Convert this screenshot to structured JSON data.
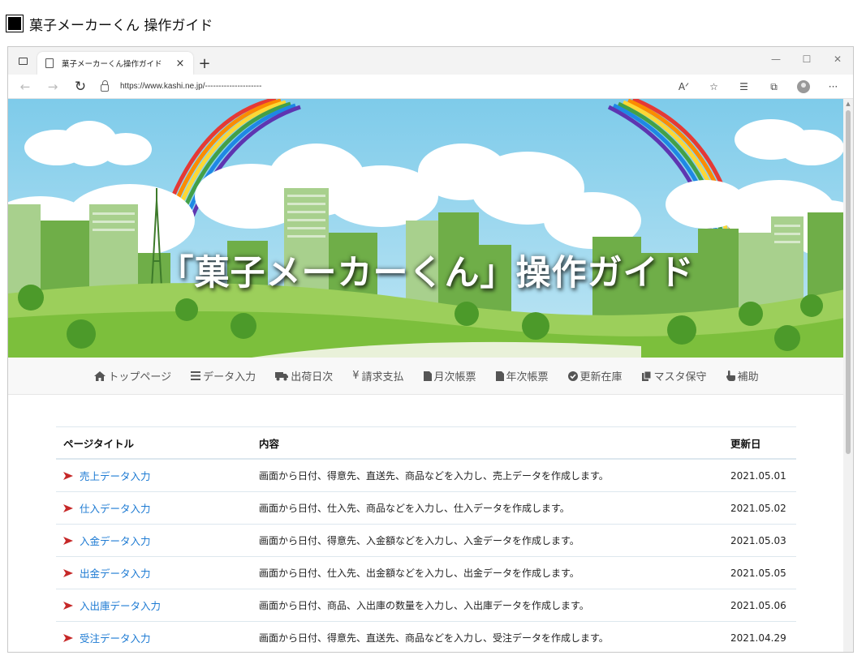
{
  "document": {
    "title": "菓子メーカーくん 操作ガイド"
  },
  "browser": {
    "tab_title": "菓子メーカーくん操作ガイド",
    "url": "https://www.kashi.ne.jp/---------------------"
  },
  "hero": {
    "title": "「菓子メーカーくん」操作ガイド"
  },
  "menu": [
    {
      "icon": "home-icon",
      "label": "トップページ"
    },
    {
      "icon": "list-icon",
      "label": "データ入力"
    },
    {
      "icon": "truck-icon",
      "label": "出荷日次"
    },
    {
      "icon": "yen-icon",
      "label": "請求支払"
    },
    {
      "icon": "document-icon",
      "label": "月次帳票"
    },
    {
      "icon": "document-icon",
      "label": "年次帳票"
    },
    {
      "icon": "check-circle-icon",
      "label": "更新在庫"
    },
    {
      "icon": "copy-icon",
      "label": "マスタ保守"
    },
    {
      "icon": "hand-pointer-icon",
      "label": "補助"
    }
  ],
  "table": {
    "headers": [
      "ページタイトル",
      "内容",
      "更新日"
    ],
    "rows": [
      {
        "title": "売上データ入力",
        "content": "画面から日付、得意先、直送先、商品などを入力し、売上データを作成します。",
        "date": "2021.05.01"
      },
      {
        "title": "仕入データ入力",
        "content": "画面から日付、仕入先、商品などを入力し、仕入データを作成します。",
        "date": "2021.05.02"
      },
      {
        "title": "入金データ入力",
        "content": "画面から日付、得意先、入金額などを入力し、入金データを作成します。",
        "date": "2021.05.03"
      },
      {
        "title": "出金データ入力",
        "content": "画面から日付、仕入先、出金額などを入力し、出金データを作成します。",
        "date": "2021.05.05"
      },
      {
        "title": "入出庫データ入力",
        "content": "画面から日付、商品、入出庫の数量を入力し、入出庫データを作成します。",
        "date": "2021.05.06"
      },
      {
        "title": "受注データ入力",
        "content": "画面から日付、得意先、直送先、商品などを入力し、受注データを作成します。",
        "date": "2021.04.29"
      }
    ]
  }
}
